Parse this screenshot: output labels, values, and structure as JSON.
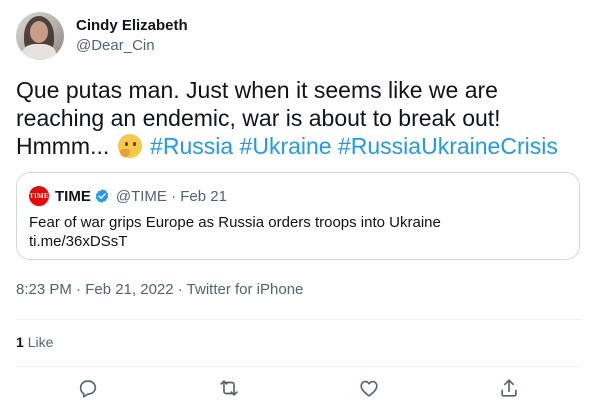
{
  "author": {
    "display_name": "Cindy Elizabeth",
    "handle": "@Dear_Cin"
  },
  "tweet": {
    "text_plain": "Que putas man. Just when it seems like we are reaching an endemic, war is about to break out! Hmmm...",
    "hashtags": [
      "#Russia",
      "#Ukraine",
      "#RussiaUkraineCrisis"
    ],
    "emoji": "thinking-face"
  },
  "quoted_tweet": {
    "logo_text": "TIME",
    "name": "TIME",
    "handle_date": "@TIME · Feb 21",
    "text": "Fear of war grips Europe as Russia orders troops into Ukraine",
    "link": "ti.me/36xDSsT"
  },
  "meta": {
    "timestamp": "8:23 PM · Feb 21, 2022 · Twitter for iPhone"
  },
  "stats": {
    "likes_count": "1",
    "likes_label": "Like"
  },
  "colors": {
    "accent": "#1d9bf0",
    "text": "#0f1419",
    "muted": "#536471",
    "border": "#cfd9de",
    "time_red": "#e90606"
  },
  "icons": [
    "reply-icon",
    "retweet-icon",
    "like-icon",
    "share-icon",
    "verified-badge-icon"
  ]
}
